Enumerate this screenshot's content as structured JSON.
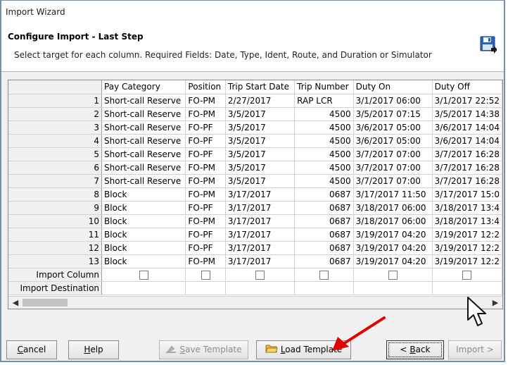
{
  "window": {
    "title": "Import Wizard"
  },
  "header": {
    "title": "Configure Import - Last Step",
    "subtitle": "Select target for each column. Required Fields: Date, Type, Ident, Route, and Duration or Simulator",
    "icon": "save-disk-icon"
  },
  "grid": {
    "columns": [
      "Pay Category",
      "Position",
      "Trip Start Date",
      "Trip Number",
      "Duty On",
      "Duty Off"
    ],
    "rows": [
      {
        "n": "1",
        "pay": "Short-call Reserve",
        "pos": "FO-PM",
        "start": "2/27/2017",
        "trip": "RAP LCR",
        "on": "3/1/2017 06:00",
        "off": "3/1/2017 22:52"
      },
      {
        "n": "2",
        "pay": "Short-call Reserve",
        "pos": "FO-PM",
        "start": "3/5/2017",
        "trip": "4500",
        "on": "3/5/2017 07:15",
        "off": "3/5/2017 14:38"
      },
      {
        "n": "3",
        "pay": "Short-call Reserve",
        "pos": "FO-PF",
        "start": "3/5/2017",
        "trip": "4500",
        "on": "3/6/2017 05:00",
        "off": "3/6/2017 14:04"
      },
      {
        "n": "4",
        "pay": "Short-call Reserve",
        "pos": "FO-PF",
        "start": "3/5/2017",
        "trip": "4500",
        "on": "3/6/2017 05:00",
        "off": "3/6/2017 14:04"
      },
      {
        "n": "5",
        "pay": "Short-call Reserve",
        "pos": "FO-PF",
        "start": "3/5/2017",
        "trip": "4500",
        "on": "3/7/2017 07:00",
        "off": "3/7/2017 16:28"
      },
      {
        "n": "6",
        "pay": "Short-call Reserve",
        "pos": "FO-PM",
        "start": "3/5/2017",
        "trip": "4500",
        "on": "3/7/2017 07:00",
        "off": "3/7/2017 16:28"
      },
      {
        "n": "7",
        "pay": "Short-call Reserve",
        "pos": "FO-PM",
        "start": "3/5/2017",
        "trip": "4500",
        "on": "3/7/2017 07:00",
        "off": "3/7/2017 16:28"
      },
      {
        "n": "8",
        "pay": "Block",
        "pos": "FO-PM",
        "start": "3/17/2017",
        "trip": "0687",
        "on": "3/17/2017 11:50",
        "off": "3/17/2017 15:0"
      },
      {
        "n": "9",
        "pay": "Block",
        "pos": "FO-PF",
        "start": "3/17/2017",
        "trip": "0687",
        "on": "3/18/2017 06:00",
        "off": "3/18/2017 13:4"
      },
      {
        "n": "10",
        "pay": "Block",
        "pos": "FO-PM",
        "start": "3/17/2017",
        "trip": "0687",
        "on": "3/18/2017 06:00",
        "off": "3/18/2017 13:4"
      },
      {
        "n": "11",
        "pay": "Block",
        "pos": "FO-PF",
        "start": "3/17/2017",
        "trip": "0687",
        "on": "3/19/2017 04:20",
        "off": "3/19/2017 12:2"
      },
      {
        "n": "12",
        "pay": "Block",
        "pos": "FO-PF",
        "start": "3/17/2017",
        "trip": "0687",
        "on": "3/19/2017 04:20",
        "off": "3/19/2017 12:2"
      },
      {
        "n": "13",
        "pay": "Block",
        "pos": "FO-PM",
        "start": "3/17/2017",
        "trip": "0687",
        "on": "3/19/2017 04:20",
        "off": "3/19/2017 12:2"
      }
    ],
    "import_column_label": "Import Column",
    "import_destination_label": "Import Destination"
  },
  "buttons": {
    "cancel_pre": "",
    "cancel_key": "C",
    "cancel_post": "ancel",
    "help_key": "H",
    "help_post": "elp",
    "save_key": "S",
    "save_post": "ave Template",
    "load_key": "L",
    "load_post": "oad Template",
    "back_pre": "< ",
    "back_key": "B",
    "back_post": "ack",
    "import_label": "Import >"
  },
  "colors": {
    "annotation_arrow": "#e00000",
    "accent": "#1f4e9a"
  }
}
